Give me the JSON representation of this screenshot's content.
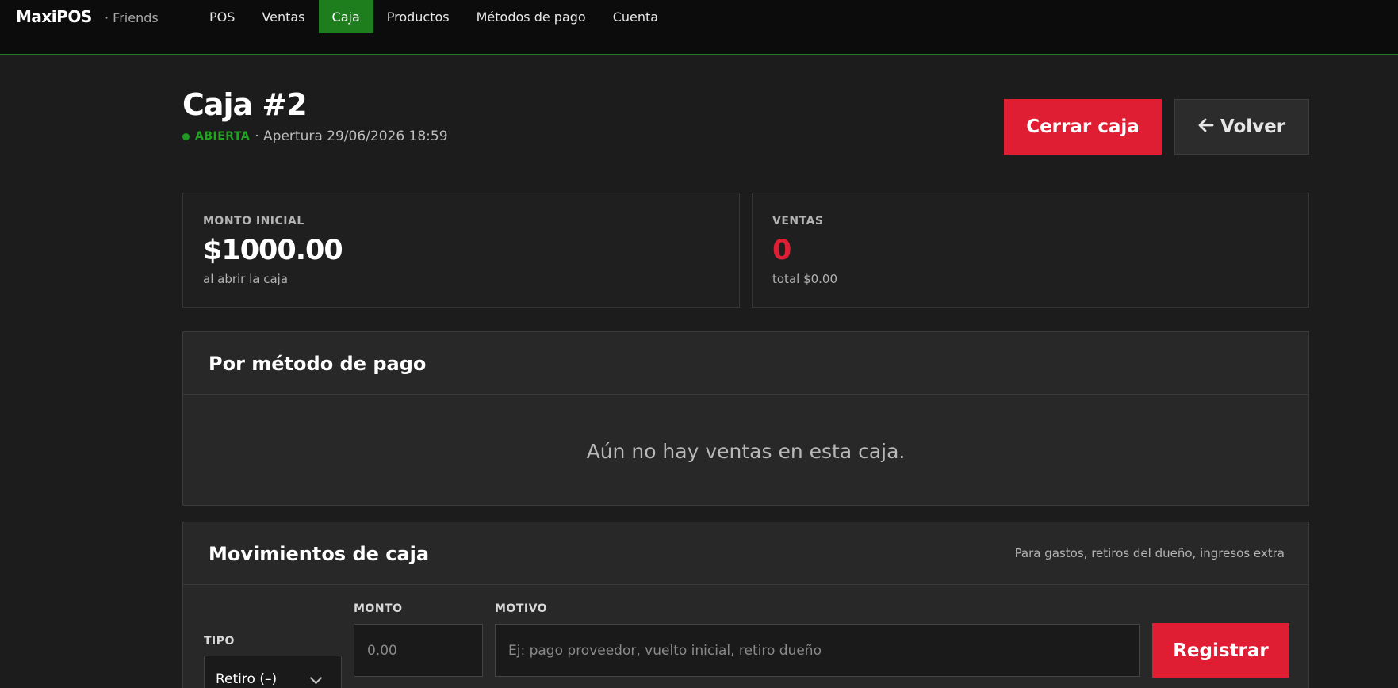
{
  "navbar": {
    "brand": "MaxiPOS",
    "brand_sub": "· Friends",
    "items": [
      {
        "label": "POS"
      },
      {
        "label": "Ventas"
      },
      {
        "label": "Caja",
        "active": true
      },
      {
        "label": "Productos"
      },
      {
        "label": "Métodos de pago"
      },
      {
        "label": "Cuenta"
      }
    ]
  },
  "header": {
    "title": "Caja #2",
    "status": "ABIERTA",
    "opened": "· Apertura 29/06/2026 18:59",
    "close_button": "Cerrar caja",
    "back_button": "Volver",
    "back_icon": "arrow-left-icon"
  },
  "cards": {
    "initial": {
      "label": "MONTO INICIAL",
      "value": "$1000.00",
      "sub": "al abrir la caja"
    },
    "sales": {
      "label": "VENTAS",
      "value": "0",
      "sub": "total $0.00"
    }
  },
  "payments": {
    "title": "Por método de pago",
    "empty": "Aún no hay ventas en esta caja."
  },
  "movements": {
    "title": "Movimientos de caja",
    "hint": "Para gastos, retiros del dueño, ingresos extra",
    "type_label": "TIPO",
    "type_value": "Retiro (–)",
    "amount_label": "MONTO",
    "amount_placeholder": "0.00",
    "reason_label": "MOTIVO",
    "reason_placeholder": "Ej: pago proveedor, vuelto inicial, retiro dueño",
    "register_button": "Registrar"
  },
  "colors": {
    "accent_green": "#1e7e1e",
    "danger_red": "#e01e33",
    "background": "#1c1c1c"
  }
}
